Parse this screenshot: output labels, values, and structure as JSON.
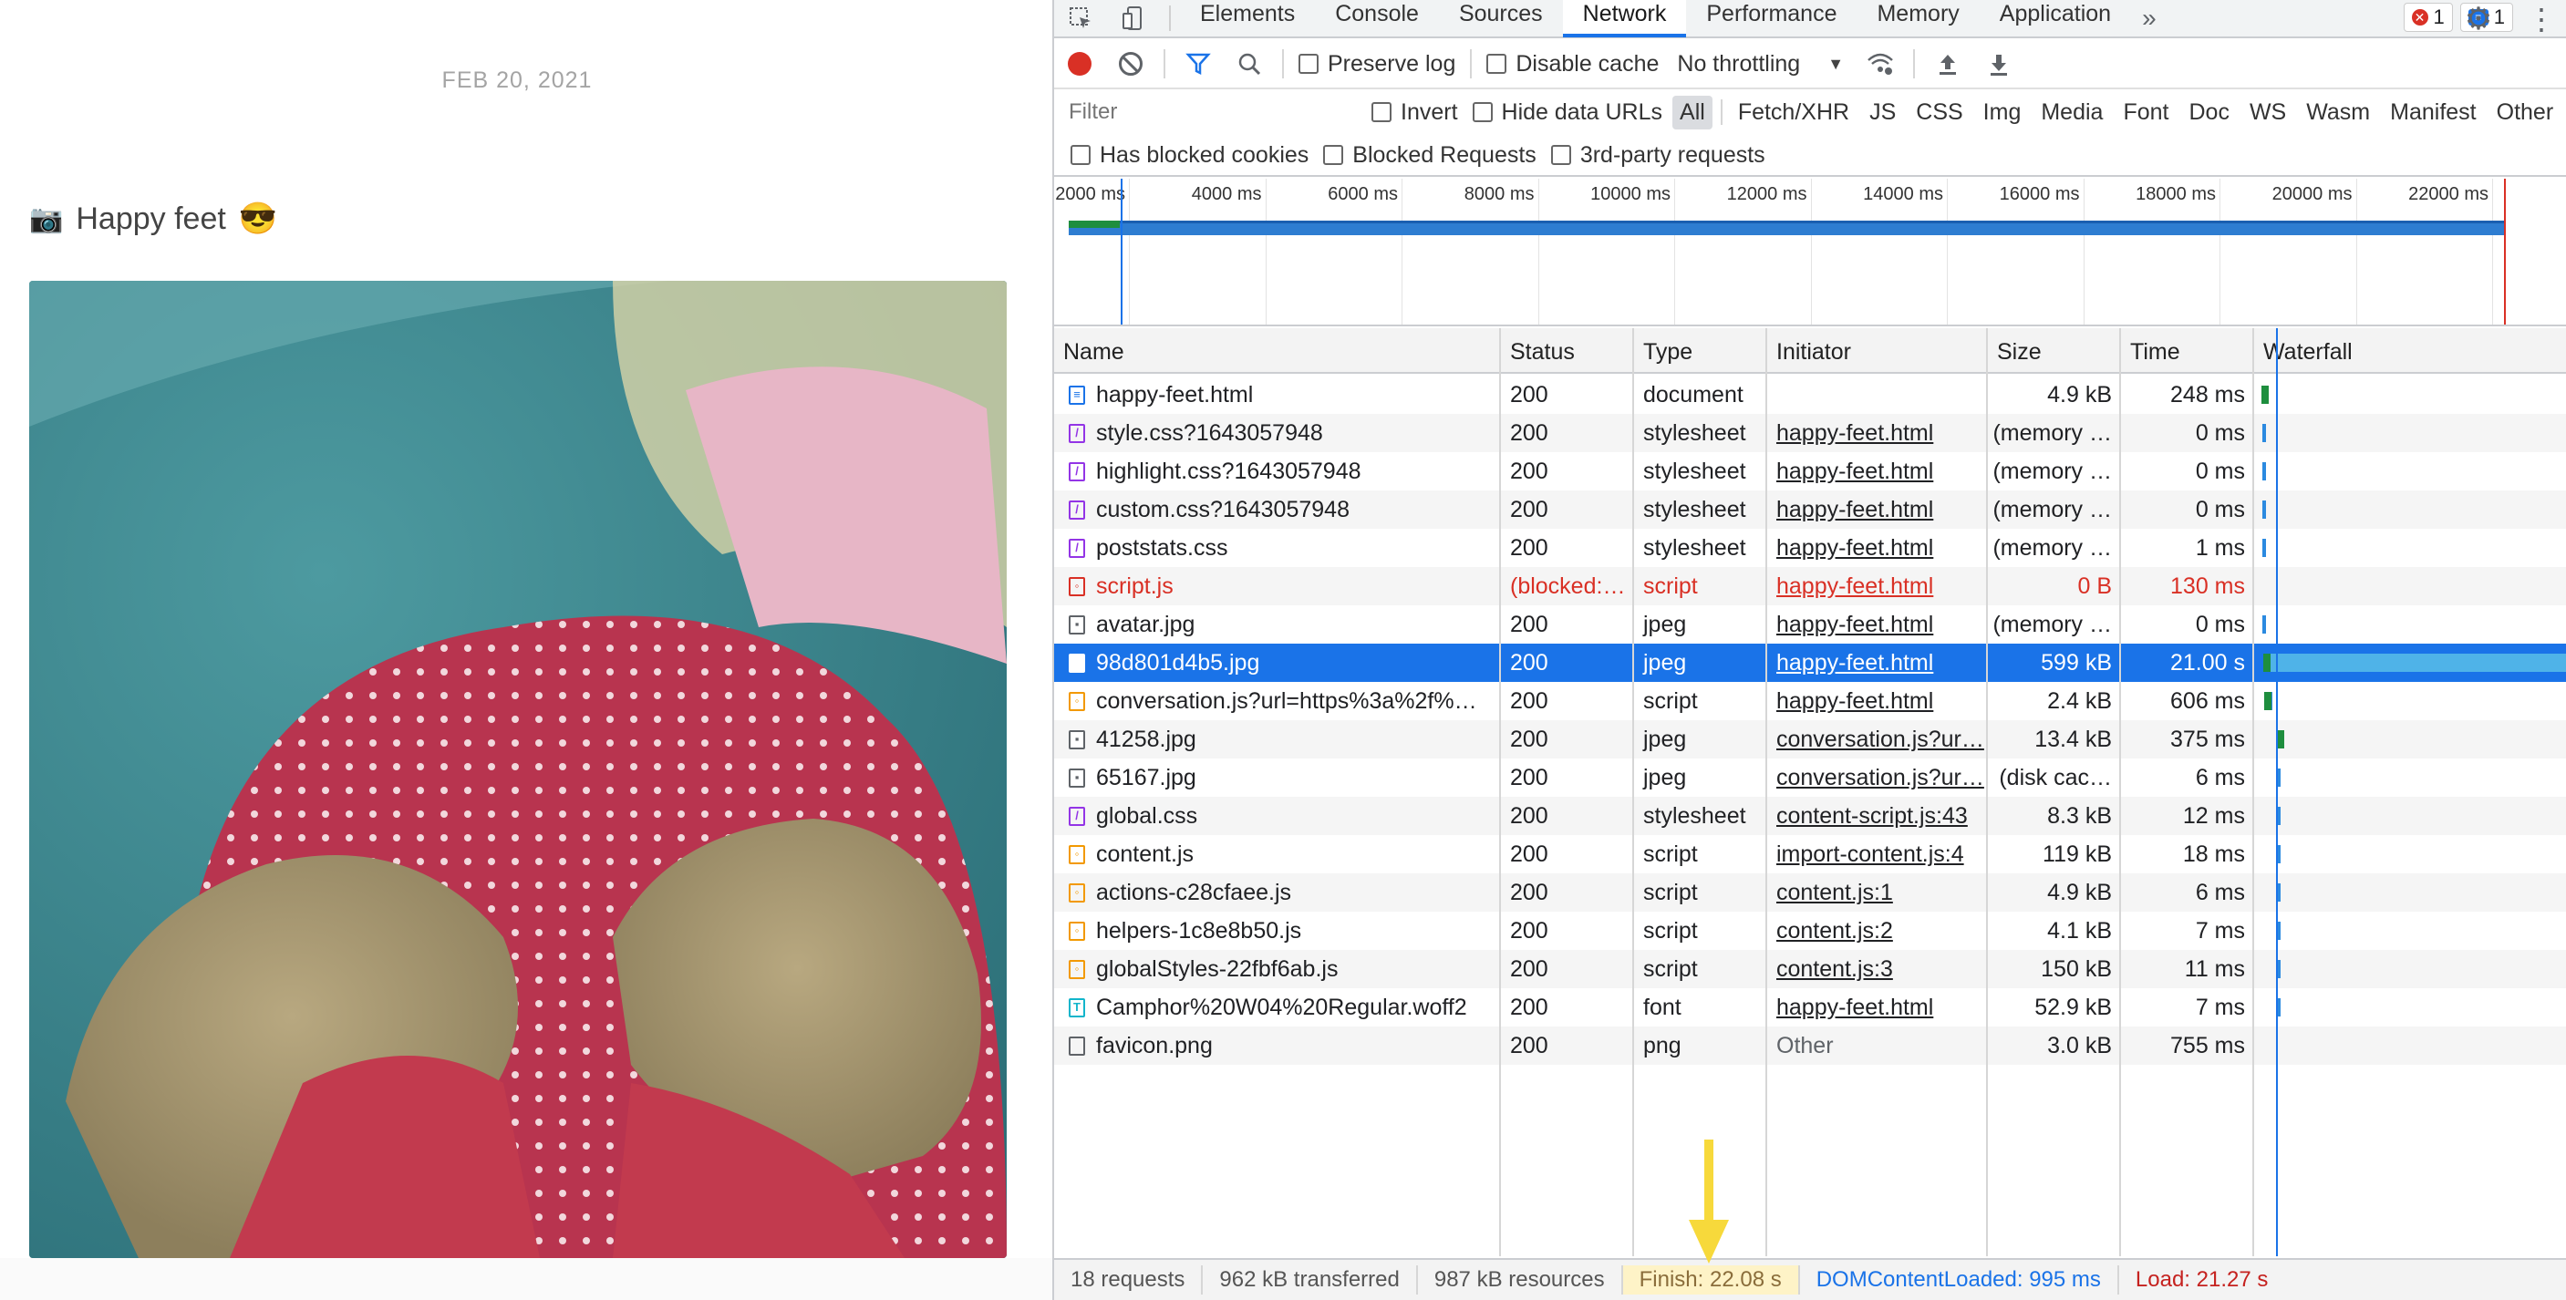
{
  "post": {
    "date": "FEB 20, 2021",
    "title_icon": "📷",
    "title": "Happy feet",
    "title_emoji": "😎"
  },
  "devtools": {
    "tabs": [
      "Elements",
      "Console",
      "Sources",
      "Network",
      "Performance",
      "Memory",
      "Application"
    ],
    "active_tab": "Network",
    "error_count": "1",
    "message_count": "1",
    "toolbar": {
      "preserve_log": "Preserve log",
      "disable_cache": "Disable cache",
      "throttling": "No throttling"
    },
    "filter": {
      "placeholder": "Filter",
      "invert": "Invert",
      "hide_data_urls": "Hide data URLs",
      "types": [
        "All",
        "Fetch/XHR",
        "JS",
        "CSS",
        "Img",
        "Media",
        "Font",
        "Doc",
        "WS",
        "Wasm",
        "Manifest",
        "Other"
      ],
      "active_type": "All",
      "has_blocked_cookies": "Has blocked cookies",
      "blocked_requests": "Blocked Requests",
      "third_party": "3rd-party requests"
    },
    "overview_ticks": [
      "2000 ms",
      "4000 ms",
      "6000 ms",
      "8000 ms",
      "10000 ms",
      "12000 ms",
      "14000 ms",
      "16000 ms",
      "18000 ms",
      "20000 ms",
      "22000 ms"
    ],
    "columns": [
      "Name",
      "Status",
      "Type",
      "Initiator",
      "Size",
      "Time",
      "Waterfall"
    ],
    "rows": [
      {
        "name": "happy-feet.html",
        "status": "200",
        "type": "document",
        "initiator": "",
        "size": "4.9 kB",
        "time": "248 ms",
        "icon": "doc-icon",
        "wf_start": 0.0,
        "wf_len": 0.011
      },
      {
        "name": "style.css?1643057948",
        "status": "200",
        "type": "stylesheet",
        "initiator": "happy-feet.html",
        "size": "(memory …",
        "time": "0 ms",
        "icon": "css-icon",
        "wf_start": 0.004,
        "wf_len": 0.0
      },
      {
        "name": "highlight.css?1643057948",
        "status": "200",
        "type": "stylesheet",
        "initiator": "happy-feet.html",
        "size": "(memory …",
        "time": "0 ms",
        "icon": "css-icon",
        "wf_start": 0.004,
        "wf_len": 0.0
      },
      {
        "name": "custom.css?1643057948",
        "status": "200",
        "type": "stylesheet",
        "initiator": "happy-feet.html",
        "size": "(memory …",
        "time": "0 ms",
        "icon": "css-icon",
        "wf_start": 0.004,
        "wf_len": 0.0
      },
      {
        "name": "poststats.css",
        "status": "200",
        "type": "stylesheet",
        "initiator": "happy-feet.html",
        "size": "(memory …",
        "time": "1 ms",
        "icon": "css-icon",
        "wf_start": 0.004,
        "wf_len": 0.0
      },
      {
        "name": "script.js",
        "status": "(blocked:…",
        "type": "script",
        "initiator": "happy-feet.html",
        "size": "0 B",
        "time": "130 ms",
        "icon": "js-error-icon",
        "error": true,
        "wf_start": 0,
        "wf_len": 0
      },
      {
        "name": "avatar.jpg",
        "status": "200",
        "type": "jpeg",
        "initiator": "happy-feet.html",
        "size": "(memory …",
        "time": "0 ms",
        "icon": "image-icon",
        "wf_start": 0.004,
        "wf_len": 0.0
      },
      {
        "name": "98d801d4b5.jpg",
        "status": "200",
        "type": "jpeg",
        "initiator": "happy-feet.html",
        "size": "599 kB",
        "time": "21.00 s",
        "icon": "image-icon",
        "selected": true,
        "wf_start": 0.006,
        "wf_len": 1.0
      },
      {
        "name": "conversation.js?url=https%3a%2f%…",
        "status": "200",
        "type": "script",
        "initiator": "happy-feet.html",
        "size": "2.4 kB",
        "time": "606 ms",
        "icon": "js-icon",
        "wf_start": 0.01,
        "wf_len": 0.027
      },
      {
        "name": "41258.jpg",
        "status": "200",
        "type": "jpeg",
        "initiator": "conversation.js?ur…",
        "size": "13.4 kB",
        "time": "375 ms",
        "icon": "image-icon",
        "wf_start": 0.05,
        "wf_len": 0.017
      },
      {
        "name": "65167.jpg",
        "status": "200",
        "type": "jpeg",
        "initiator": "conversation.js?ur…",
        "size": "(disk cac…",
        "time": "6 ms",
        "icon": "image-icon",
        "wf_start": 0.05,
        "wf_len": 0.0
      },
      {
        "name": "global.css",
        "status": "200",
        "type": "stylesheet",
        "initiator": "content-script.js:43",
        "size": "8.3 kB",
        "time": "12 ms",
        "icon": "css-icon",
        "wf_start": 0.05,
        "wf_len": 0.0
      },
      {
        "name": "content.js",
        "status": "200",
        "type": "script",
        "initiator": "import-content.js:4",
        "size": "119 kB",
        "time": "18 ms",
        "icon": "js-icon",
        "wf_start": 0.052,
        "wf_len": 0.0
      },
      {
        "name": "actions-c28cfaee.js",
        "status": "200",
        "type": "script",
        "initiator": "content.js:1",
        "size": "4.9 kB",
        "time": "6 ms",
        "icon": "js-icon",
        "wf_start": 0.052,
        "wf_len": 0.0
      },
      {
        "name": "helpers-1c8e8b50.js",
        "status": "200",
        "type": "script",
        "initiator": "content.js:2",
        "size": "4.1 kB",
        "time": "7 ms",
        "icon": "js-icon",
        "wf_start": 0.052,
        "wf_len": 0.0
      },
      {
        "name": "globalStyles-22fbf6ab.js",
        "status": "200",
        "type": "script",
        "initiator": "content.js:3",
        "size": "150 kB",
        "time": "11 ms",
        "icon": "js-icon",
        "wf_start": 0.052,
        "wf_len": 0.0
      },
      {
        "name": "Camphor%20W04%20Regular.woff2",
        "status": "200",
        "type": "font",
        "initiator": "happy-feet.html",
        "size": "52.9 kB",
        "time": "7 ms",
        "icon": "font-icon",
        "wf_start": 0.052,
        "wf_len": 0.0
      },
      {
        "name": "favicon.png",
        "status": "200",
        "type": "png",
        "initiator": "Other",
        "size": "3.0 kB",
        "time": "755 ms",
        "icon": "blank-icon",
        "plain_initiator": true,
        "wf_start": 0,
        "wf_len": 0
      }
    ],
    "status_bar": {
      "requests": "18 requests",
      "transferred": "962 kB transferred",
      "resources": "987 kB resources",
      "finish": "Finish: 22.08 s",
      "dom_content_loaded": "DOMContentLoaded: 995 ms",
      "load": "Load: 21.27 s"
    },
    "colors": {
      "accent": "#1a73e8",
      "error": "#d93025",
      "highlight_arrow": "#f7d93b"
    }
  }
}
